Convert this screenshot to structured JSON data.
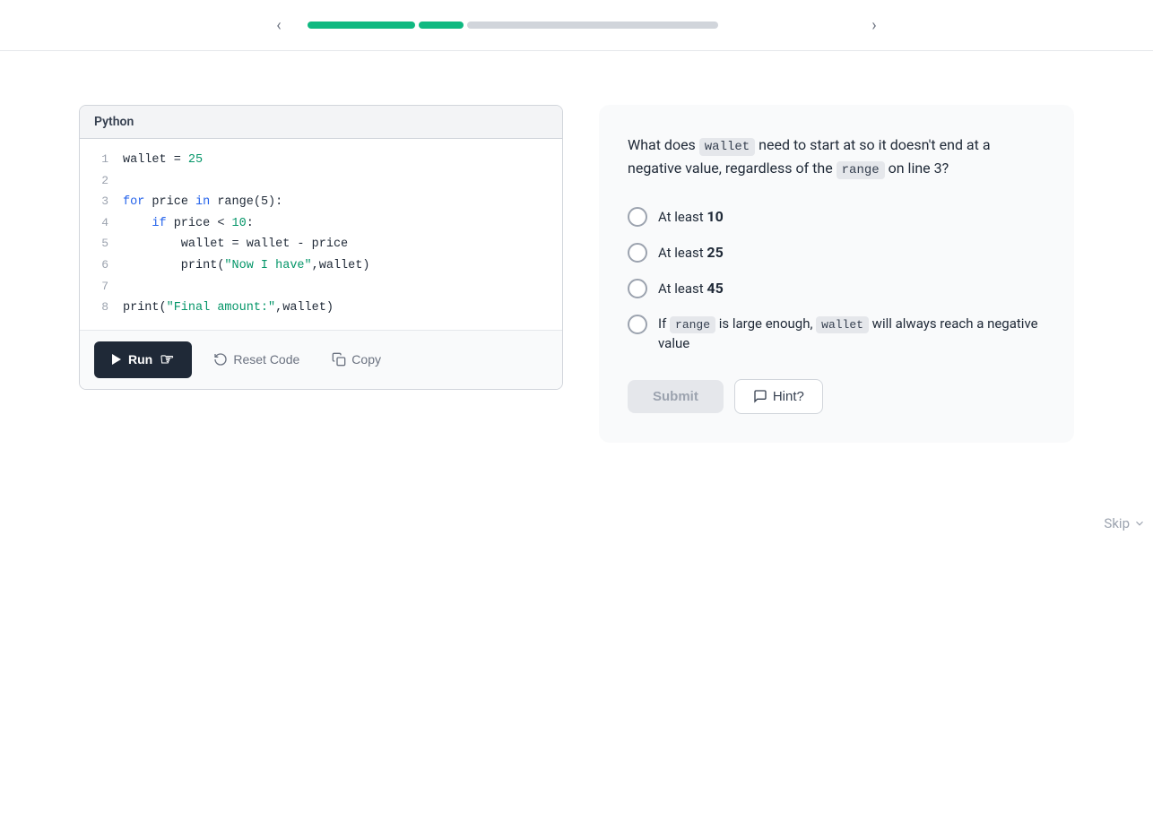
{
  "nav": {
    "prev_label": "‹",
    "next_label": "›",
    "progress": {
      "seg1_label": "segment-1",
      "seg2_label": "segment-2",
      "seg3_label": "segment-3"
    }
  },
  "code_panel": {
    "header_label": "Python",
    "lines": [
      {
        "num": "1",
        "html_key": "line1"
      },
      {
        "num": "2",
        "html_key": "line2"
      },
      {
        "num": "3",
        "html_key": "line3"
      },
      {
        "num": "4",
        "html_key": "line4"
      },
      {
        "num": "5",
        "html_key": "line5"
      },
      {
        "num": "6",
        "html_key": "line6"
      },
      {
        "num": "7",
        "html_key": "line7"
      },
      {
        "num": "8",
        "html_key": "line8"
      }
    ],
    "toolbar": {
      "run_label": "Run",
      "reset_label": "Reset Code",
      "copy_label": "Copy"
    }
  },
  "question": {
    "intro": "What does",
    "code1": "wallet",
    "middle": "need to start at so it doesn't end at a negative value, regardless of the",
    "code2": "range",
    "end": "on line 3?",
    "options": [
      {
        "id": "opt1",
        "label_prefix": "At least ",
        "bold": "10",
        "label_suffix": ""
      },
      {
        "id": "opt2",
        "label_prefix": "At least ",
        "bold": "25",
        "label_suffix": ""
      },
      {
        "id": "opt3",
        "label_prefix": "At least ",
        "bold": "45",
        "label_suffix": ""
      },
      {
        "id": "opt4",
        "label_prefix": "If ",
        "code": "range",
        "label_middle": " is large enough, ",
        "code2": "wallet",
        "label_end": " will always reach a negative value"
      }
    ],
    "submit_label": "Submit",
    "hint_label": "Hint?",
    "skip_label": "Skip"
  }
}
